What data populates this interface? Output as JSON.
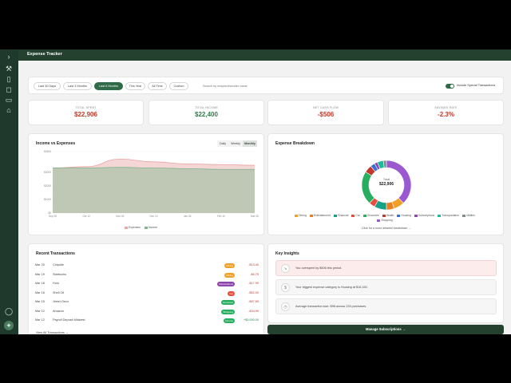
{
  "app": {
    "title": "Expense Tracker"
  },
  "rail": {
    "icons": [
      "chevron-right-icon",
      "wrench-icon",
      "book-icon",
      "chat-icon",
      "document-icon",
      "bookmark-icon",
      "user-icon",
      "compass-icon"
    ]
  },
  "filters": {
    "ranges": [
      "Last 30 Days",
      "Last 3 Months",
      "Last 6 Months",
      "This Year",
      "All Time",
      "Custom"
    ],
    "active": "Last 6 Months",
    "search_placeholder": "Search by recipient/sender name",
    "toggle_label": "Include Special Transactions",
    "toggle_on": true
  },
  "stats": [
    {
      "label": "TOTAL SPENT",
      "value": "$22,906",
      "color": "#c0392b"
    },
    {
      "label": "TOTAL INCOME",
      "value": "$22,400",
      "color": "#2e7d4a"
    },
    {
      "label": "NET CASH FLOW",
      "value": "-$506",
      "color": "#c0392b"
    },
    {
      "label": "SAVINGS RATE",
      "value": "-2.3%",
      "color": "#c0392b"
    }
  ],
  "income_chart": {
    "title": "Income vs Expenses",
    "granularity": [
      "Daily",
      "Weekly",
      "Monthly"
    ],
    "active_granularity": "Monthly",
    "legend": [
      "Expenses",
      "Income"
    ]
  },
  "chart_data": {
    "type": "area",
    "x": [
      "Sep 26",
      "Oct 12",
      "Nov 26",
      "Dec 10",
      "Jan 26",
      "Feb 10",
      "Mar 26"
    ],
    "yticks": [
      "$4500",
      "$3000",
      "$2000",
      "$1000",
      "$0"
    ],
    "ylim": [
      0,
      4500
    ],
    "series": [
      {
        "name": "Expenses",
        "color": "#e8a3a3",
        "values": [
          3300,
          3400,
          3950,
          3750,
          3600,
          3550,
          3500
        ]
      },
      {
        "name": "Income",
        "color": "#7fb58f",
        "values": [
          3300,
          3300,
          3350,
          3300,
          3250,
          3200,
          3200
        ]
      }
    ]
  },
  "breakdown": {
    "title": "Expense Breakdown",
    "center_label": "Total",
    "center_value": "$22,906",
    "footer_link": "Click for a more detailed breakdown →",
    "slices": [
      {
        "name": "Shopping",
        "value": 38,
        "color": "#9b59d0"
      },
      {
        "name": "Dining",
        "value": 7,
        "color": "#f1a027"
      },
      {
        "name": "Entertainment",
        "value": 5,
        "color": "#e67e22"
      },
      {
        "name": "Financial",
        "value": 8,
        "color": "#16a085"
      },
      {
        "name": "Car",
        "value": 4,
        "color": "#e74c3c"
      },
      {
        "name": "Groceries",
        "value": 22,
        "color": "#27ae60"
      },
      {
        "name": "Health",
        "value": 5,
        "color": "#c0392b"
      },
      {
        "name": "Housing",
        "value": 3,
        "color": "#3a6fd8"
      },
      {
        "name": "Subscriptions",
        "value": 2,
        "color": "#8e44ad"
      },
      {
        "name": "Transportation",
        "value": 4,
        "color": "#1abc9c"
      },
      {
        "name": "Utilities",
        "value": 2,
        "color": "#7f8c8d"
      }
    ]
  },
  "transactions": {
    "title": "Recent Transactions",
    "rows": [
      {
        "date": "Mar 20",
        "name": "Chipotle",
        "category": "Dining",
        "cat_color": "#f1a027",
        "amount": "-$13.40"
      },
      {
        "date": "Mar 19",
        "name": "Starbucks",
        "category": "Dining",
        "cat_color": "#f1a027",
        "amount": "-$6.75"
      },
      {
        "date": "Mar 18",
        "name": "Hulu",
        "category": "Subscriptions",
        "cat_color": "#8e44ad",
        "amount": "-$17.99"
      },
      {
        "date": "Mar 16",
        "name": "Shell Oil",
        "category": "Car",
        "cat_color": "#e74c3c",
        "amount": "-$52.00"
      },
      {
        "date": "Mar 15",
        "name": "Jewel-Osco",
        "category": "Groceries",
        "cat_color": "#27ae60",
        "amount": "-$87.65"
      },
      {
        "date": "Mar 12",
        "name": "Amazon",
        "category": "Shopping",
        "cat_color": "#27ae60",
        "amount": "-$34.99"
      },
      {
        "date": "Mar 12",
        "name": "Payroll Deposit Midwest",
        "category": "Income",
        "cat_color": "#27ae60",
        "amount": "+$3,000.00"
      }
    ],
    "view_all": "View All Transactions →"
  },
  "insights": {
    "title": "Key Insights",
    "items": [
      {
        "icon": "trend-icon",
        "text": "You overspent by $506 this period.",
        "bg": "#fdecec"
      },
      {
        "icon": "dollar-icon",
        "text": "Your biggest expense category is Housing at $16,150.",
        "bg": "#f5f6f5"
      },
      {
        "icon": "clock-icon",
        "text": "Average transaction size: $98 across 233 purchases.",
        "bg": "#f5f6f5"
      }
    ],
    "button": "Manage Subscriptions →"
  }
}
